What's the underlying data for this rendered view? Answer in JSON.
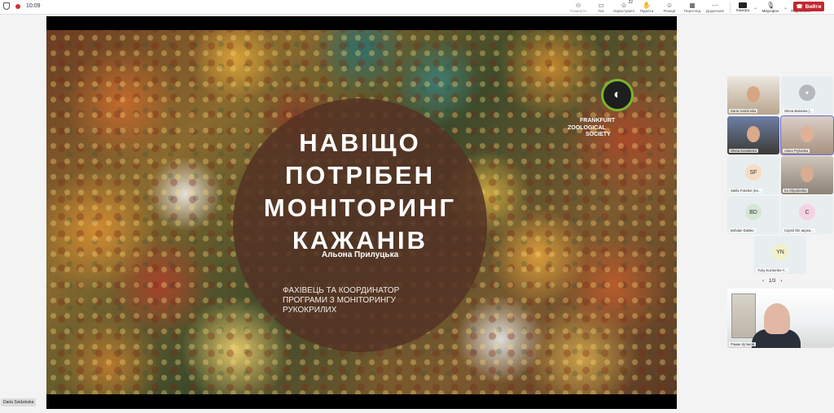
{
  "status": {
    "time": "10:09"
  },
  "toolbar": {
    "items": [
      {
        "label": "Покинути",
        "icon": "lock-icon"
      },
      {
        "label": "Чат",
        "icon": "chat-icon"
      },
      {
        "label": "Користувачі",
        "icon": "people-icon",
        "badge": "22"
      },
      {
        "label": "Підняти",
        "icon": "raise-hand-icon"
      },
      {
        "label": "Реакції",
        "icon": "reaction-icon"
      },
      {
        "label": "Перегляд",
        "icon": "view-icon"
      },
      {
        "label": "Додатково",
        "icon": "more-icon"
      }
    ],
    "camera_label": "Камера",
    "mic_label": "Мікрофон",
    "share_label": "Поділитися",
    "leave_label": "Вийти"
  },
  "slide": {
    "title_lines": [
      "НАВІЩО",
      "ПОТРІБЕН",
      "МОНІТОРИНГ",
      "КАЖАНІВ"
    ],
    "author": "Альона Прилуцька",
    "role_lines": [
      "Фахівець та координатор",
      "програми з моніторингу",
      "рукокрилих"
    ],
    "logo_lines": [
      "FRANKFURT",
      "ZOOLOGICAL",
      "SOCIETY"
    ]
  },
  "self_view": {
    "name": "Daria Svidzinska"
  },
  "participants": [
    {
      "name": "Daria Svidzinska",
      "initials": "",
      "type": "photo"
    },
    {
      "name": "Olena Bulavina (...",
      "initials": "",
      "type": "generic"
    },
    {
      "name": "Olena Kovalenko",
      "initials": "",
      "type": "photo"
    },
    {
      "name": "Alona Prylutska",
      "initials": "",
      "type": "photo"
    },
    {
      "name": "Stella Fokshei (Ke...",
      "initials": "SF",
      "type": "initials"
    },
    {
      "name": "Ira Shpakivska",
      "initials": "",
      "type": "photo"
    },
    {
      "name": "Bohdan Datsko",
      "initials": "BD",
      "type": "initials"
    },
    {
      "name": "Copnil Ole anpea...",
      "initials": "C",
      "type": "initials"
    },
    {
      "name": "Yuriy Kuznenko-Y...",
      "initials": "YN",
      "type": "initials"
    }
  ],
  "pager": {
    "label": "1/3"
  },
  "active_speaker": {
    "name": "Роман Кутиков"
  },
  "colors": {
    "leave": "#c4262e",
    "accent": "#6a67c7",
    "slide_circle": "#54322499"
  }
}
